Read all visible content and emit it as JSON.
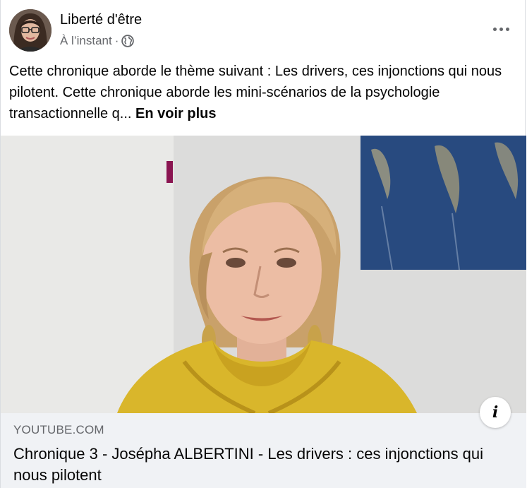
{
  "post": {
    "author": "Liberté d'être",
    "timestamp": "À l’instant",
    "separator": "·",
    "privacy_icon": "globe-icon",
    "more_icon": "more-options-icon",
    "text": "Cette chronique aborde le thème suivant : Les drivers, ces injonctions qui nous pilotent. Cette chronique aborde les mini-scénarios de la psychologie transactionnelle q...",
    "see_more": "En voir plus"
  },
  "link": {
    "domain": "YOUTUBE.COM",
    "title": "Chronique 3 - Josépha ALBERTINI - Les drivers : ces injonctions qui nous pilotent",
    "info_icon": "info-icon",
    "info_glyph": "i"
  },
  "colors": {
    "secondary_text": "#65676b",
    "footer_bg": "#f0f2f5",
    "scarf": "#d9b62b",
    "painting": "#2c4f86"
  }
}
